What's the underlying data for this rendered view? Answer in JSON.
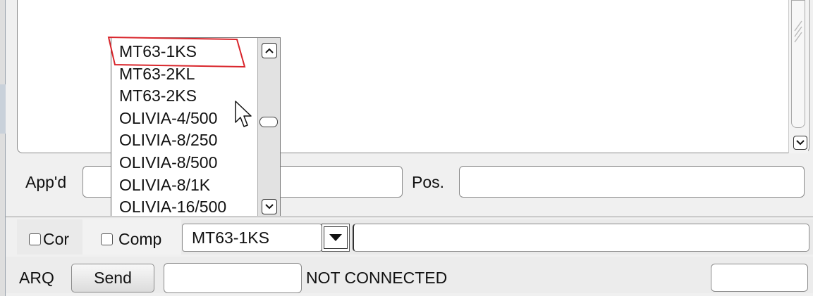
{
  "top_panel": {
    "appd_label": "App'd",
    "pos_label": "Pos."
  },
  "mode_row": {
    "checkbox1_label": "Cor",
    "checkbox2_label": "Comp",
    "selected_mode": "MT63-1KS"
  },
  "dropdown": {
    "items": [
      "MT63-1KS",
      "MT63-2KL",
      "MT63-2KS",
      "OLIVIA-4/500",
      "OLIVIA-8/250",
      "OLIVIA-8/500",
      "OLIVIA-8/1K",
      "OLIVIA-16/500"
    ],
    "highlight_color": "#d9262c"
  },
  "arq_row": {
    "arq_label": "ARQ",
    "send_label": "Send",
    "status": "NOT CONNECTED"
  }
}
